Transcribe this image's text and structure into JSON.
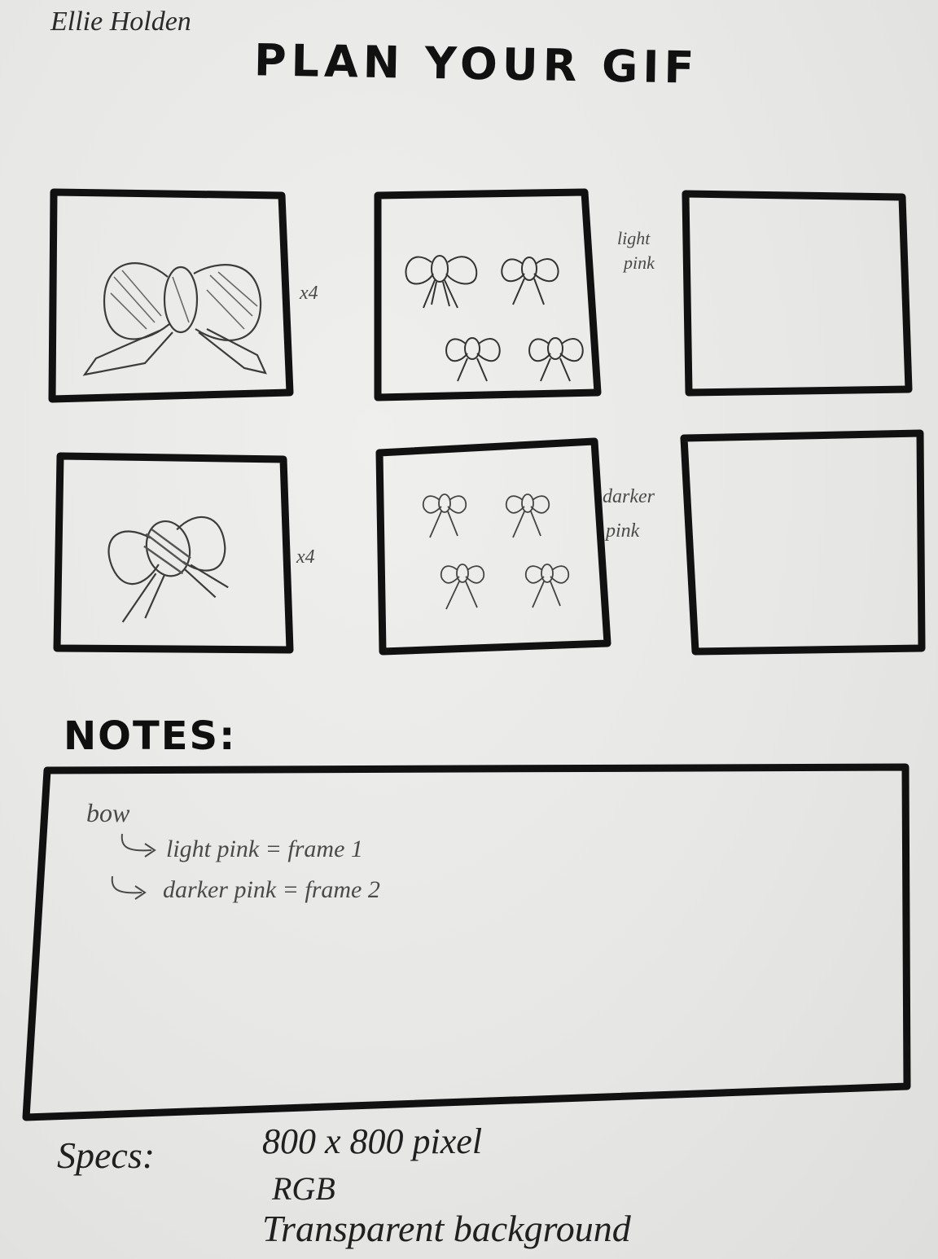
{
  "author": "Ellie Holden",
  "title": "PLAN YOUR GIF",
  "frames": [
    {
      "side_note": "x4"
    },
    {
      "side_note_line1": "light",
      "side_note_line2": "pink"
    },
    {},
    {
      "side_note": "x4"
    },
    {
      "side_note_line1": "darker",
      "side_note_line2": "pink"
    },
    {}
  ],
  "notes": {
    "heading": "NOTES:",
    "lines": [
      "bow",
      "light pink = frame 1",
      "darker pink = frame 2"
    ]
  },
  "specs": {
    "label": "Specs:",
    "lines": [
      "800 x 800 pixel",
      "RGB",
      "Transparent background"
    ]
  },
  "colors": {
    "paper": "#e6e6e4",
    "marker": "#111111",
    "pencil": "#4a4a4a"
  }
}
